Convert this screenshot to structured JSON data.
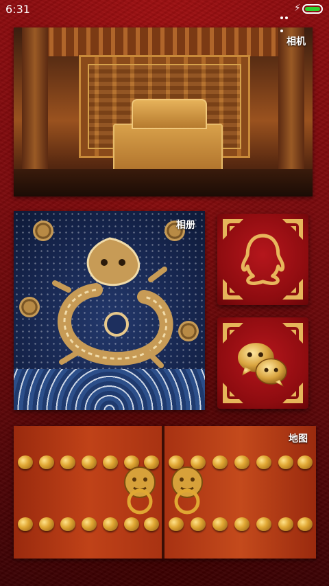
{
  "status_bar": {
    "time": "6:31",
    "battery_percent": 100,
    "battery_color": "#2fd12f"
  },
  "tiles": {
    "album_label": "相机",
    "files_label": "相册",
    "gallery_label": "地图"
  },
  "apps": {
    "qq_icon": "qq-penguin-icon",
    "wechat_icon": "wechat-chat-bubbles-icon"
  },
  "colors": {
    "background_red": "#8e0c0f",
    "gold": "#e0a733"
  }
}
